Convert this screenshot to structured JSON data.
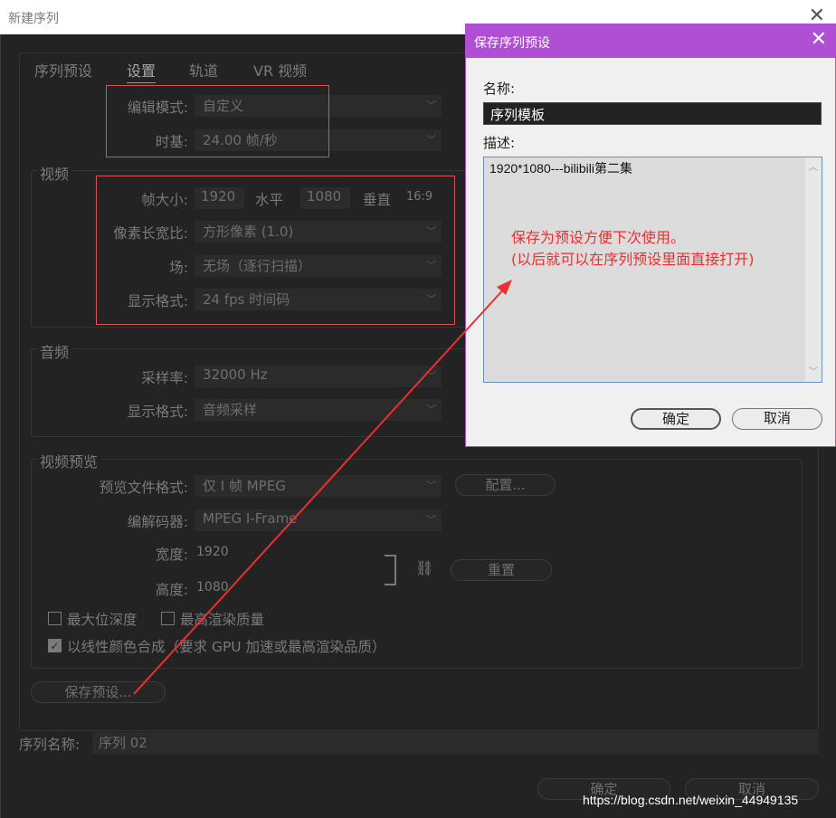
{
  "window": {
    "title": "新建序列"
  },
  "tabs": [
    {
      "label": "序列预设"
    },
    {
      "label": "设置"
    },
    {
      "label": "轨道"
    },
    {
      "label": "VR 视频"
    }
  ],
  "settings": {
    "edit_mode": {
      "label": "编辑模式:",
      "value": "自定义"
    },
    "timebase": {
      "label": "时基:",
      "value": "24.00  帧/秒"
    }
  },
  "video": {
    "title": "视频",
    "frame_size": {
      "label": "帧大小:",
      "width": "1920",
      "h_label": "水平",
      "height": "1080",
      "v_label": "垂直",
      "ratio": "16:9"
    },
    "pixel_aspect": {
      "label": "像素长宽比:",
      "value": "方形像素 (1.0)"
    },
    "fields": {
      "label": "场:",
      "value": "无场（逐行扫描）"
    },
    "display_format": {
      "label": "显示格式:",
      "value": "24 fps 时间码"
    }
  },
  "audio": {
    "title": "音频",
    "sample_rate": {
      "label": "采样率:",
      "value": "32000 Hz"
    },
    "display_format": {
      "label": "显示格式:",
      "value": "音频采样"
    }
  },
  "preview": {
    "title": "视频预览",
    "file_format": {
      "label": "预览文件格式:",
      "value": "仅 I 帧 MPEG"
    },
    "config_button": "配置...",
    "codec": {
      "label": "编解码器:",
      "value": "MPEG I-Frame"
    },
    "width": {
      "label": "宽度:",
      "value": "1920"
    },
    "height": {
      "label": "高度:",
      "value": "1080"
    },
    "reset_button": "重置",
    "max_depth": "最大位深度",
    "max_quality": "最高渲染质量",
    "linear_color": "以线性颜色合成（要求 GPU 加速或最高渲染品质）"
  },
  "save_preset_button": "保存预设...",
  "sequence_name": {
    "label": "序列名称:",
    "value": "序列 02"
  },
  "footer": {
    "ok": "确定",
    "cancel": "取消"
  },
  "dialog": {
    "title": "保存序列预设",
    "name_label": "名称:",
    "name_value": "序列模板",
    "desc_label": "描述:",
    "desc_value": "1920*1080---bilibili第二集",
    "ok": "确定",
    "cancel": "取消"
  },
  "annotation": {
    "line1": "保存为预设方便下次使用。",
    "line2": "(以后就可以在序列预设里面直接打开)"
  },
  "watermark": "https://blog.csdn.net/weixin_44949135",
  "colors": {
    "dialog_accent": "#b14fd4",
    "annotation_red": "#ee2e2e"
  }
}
